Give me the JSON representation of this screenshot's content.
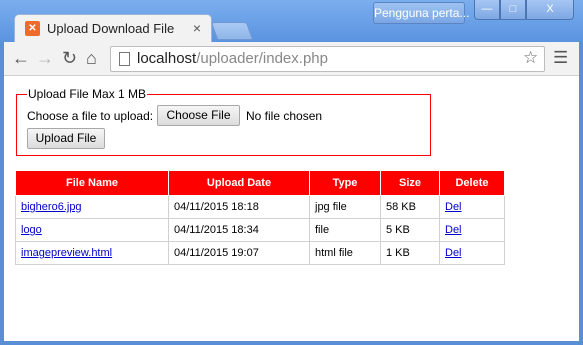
{
  "browser": {
    "tab_title": "Upload Download File",
    "tab_close": "×",
    "user_badge": "Pengguna perta...",
    "url_host": "localhost",
    "url_path": "/uploader/index.php"
  },
  "icons": {
    "back": "arrow-left-icon",
    "forward": "arrow-right-icon",
    "reload": "reload-icon",
    "home": "home-icon",
    "page": "page-icon",
    "bookmark": "star-icon",
    "menu": "hamburger-menu-icon",
    "tab_favicon": "xampp-icon"
  },
  "form": {
    "legend": "Upload File Max 1 MB",
    "choose_label": "Choose a file to upload:",
    "choose_button": "Choose File",
    "no_file": "No file chosen",
    "upload_button": "Upload File"
  },
  "table": {
    "headers": [
      "File Name",
      "Upload Date",
      "Type",
      "Size",
      "Delete"
    ],
    "rows": [
      {
        "name": "bighero6.jpg",
        "date": "04/11/2015 18:18",
        "type": "jpg file",
        "size": "58 KB",
        "delete": "Del"
      },
      {
        "name": "logo",
        "date": "04/11/2015 18:34",
        "type": "file",
        "size": "5 KB",
        "delete": "Del"
      },
      {
        "name": "imagepreview.html",
        "date": "04/11/2015 19:07",
        "type": "html file",
        "size": "1 KB",
        "delete": "Del"
      }
    ]
  },
  "colors": {
    "header_bg": "#ff0000",
    "fieldset_border": "#ff0000",
    "link": "#0000cc"
  }
}
